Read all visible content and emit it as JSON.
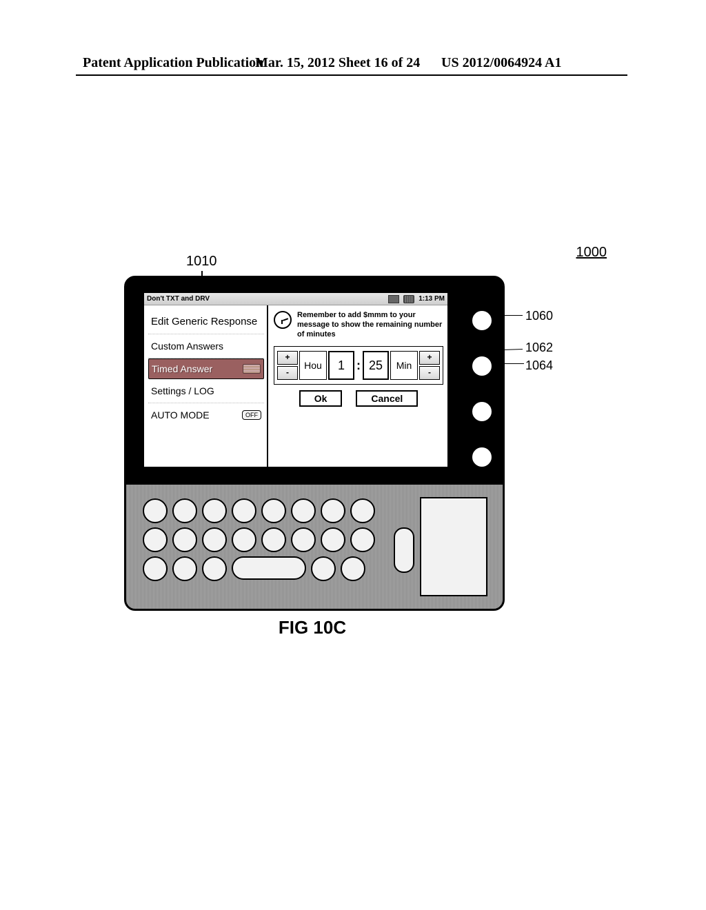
{
  "header": {
    "left": "Patent Application Publication",
    "mid": "Mar. 15, 2012  Sheet 16 of 24",
    "right": "US 2012/0064924 A1"
  },
  "refs": {
    "r1000": "1000",
    "r1010": "1010",
    "r1060": "1060",
    "r1062": "1062",
    "r1064": "1064"
  },
  "status": {
    "title": "Don't TXT and DRV",
    "time": "1:13 PM"
  },
  "menu": {
    "edit_generic": "Edit Generic Response",
    "custom_answers": "Custom Answers",
    "timed_answer": "Timed Answer",
    "settings_log": "Settings / LOG",
    "auto_mode": "AUTO MODE",
    "auto_mode_toggle": "OFF"
  },
  "hint": "Remember to add $mmm to your message to show the remaining number of minutes",
  "time_picker": {
    "plus": "+",
    "minus": "-",
    "hour_unit": "Hou",
    "min_unit": "Min",
    "hour_value": "1",
    "minute_value": "25",
    "colon": ":"
  },
  "dialog": {
    "ok": "Ok",
    "cancel": "Cancel"
  },
  "figure_caption": "FIG 10C"
}
